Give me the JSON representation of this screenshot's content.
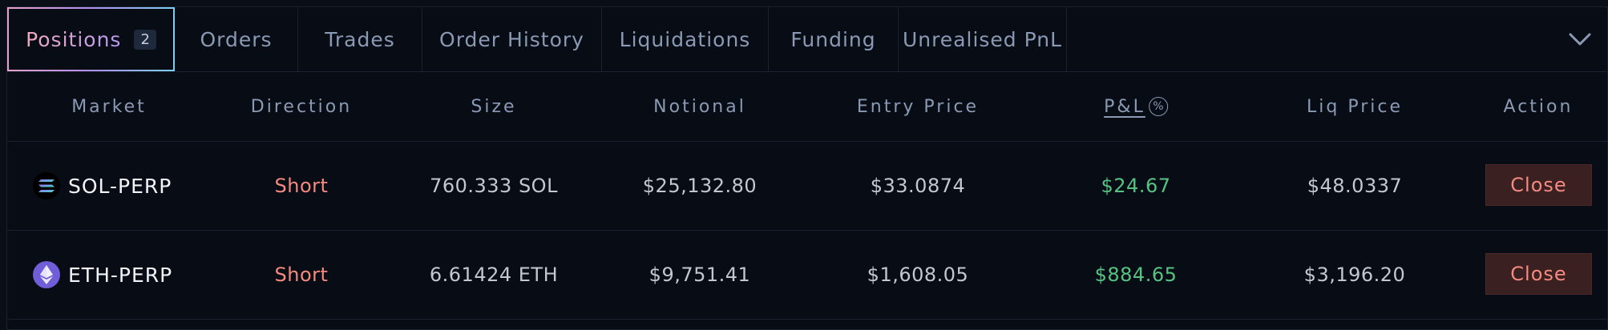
{
  "tabs": [
    {
      "label": "Positions",
      "badge": "2",
      "active": true
    },
    {
      "label": "Orders"
    },
    {
      "label": "Trades"
    },
    {
      "label": "Order History"
    },
    {
      "label": "Liquidations"
    },
    {
      "label": "Funding"
    },
    {
      "label": "Unrealised PnL"
    }
  ],
  "columns": {
    "market": "Market",
    "direction": "Direction",
    "size": "Size",
    "notional": "Notional",
    "entry_price": "Entry Price",
    "pnl": "P&L",
    "pnl_toggle": "%",
    "liq_price": "Liq Price",
    "action": "Action"
  },
  "rows": [
    {
      "market": "SOL-PERP",
      "icon": "sol-icon",
      "direction": "Short",
      "size": "760.333 SOL",
      "notional": "$25,132.80",
      "entry_price": "$33.0874",
      "pnl": "$24.67",
      "liq_price": "$48.0337",
      "action": "Close"
    },
    {
      "market": "ETH-PERP",
      "icon": "eth-icon",
      "direction": "Short",
      "size": "6.61424 ETH",
      "notional": "$9,751.41",
      "entry_price": "$1,608.05",
      "pnl": "$884.65",
      "liq_price": "$3,196.20",
      "action": "Close"
    }
  ],
  "colors": {
    "background": "#080c14",
    "short": "#f48a80",
    "profit": "#56c383",
    "close_button_bg": "#3a2020"
  }
}
